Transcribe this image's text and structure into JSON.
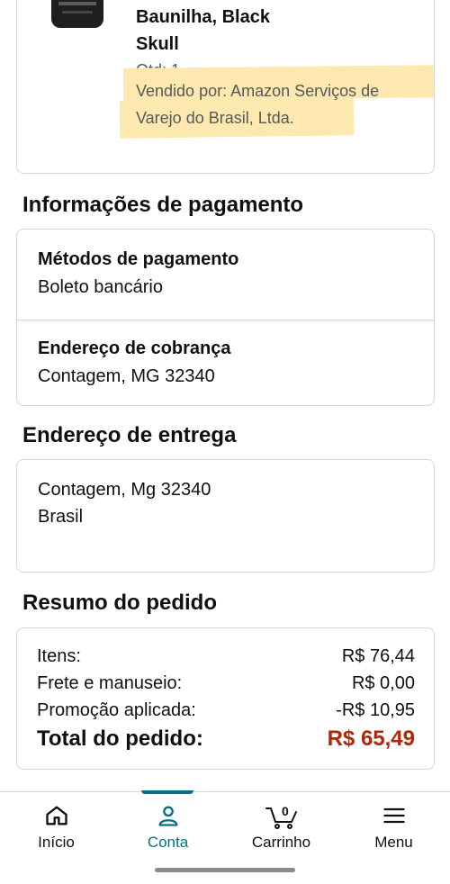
{
  "product": {
    "name_line1": "Baunilha, Black",
    "name_line2": "Skull",
    "quantity": "Qtd: 1",
    "seller_line1": "Vendido por: Amazon Serviços de",
    "seller_line2": "Varejo do Brasil, Ltda."
  },
  "payment": {
    "section_title": "Informações de pagamento",
    "methods_label": "Métodos de pagamento",
    "methods_value": "Boleto bancário",
    "billing_label": "Endereço de cobrança",
    "billing_value": "Contagem, MG 32340"
  },
  "shipping": {
    "section_title": "Endereço de entrega",
    "line1": "Contagem, Mg 32340",
    "line2": "Brasil"
  },
  "summary": {
    "section_title": "Resumo do pedido",
    "rows": [
      {
        "label": "Itens:",
        "amount": "R$ 76,44"
      },
      {
        "label": "Frete e manuseio:",
        "amount": "R$ 0,00"
      },
      {
        "label": "Promoção aplicada:",
        "amount": "-R$ 10,95"
      }
    ],
    "total_label": "Total do pedido:",
    "total_amount": "R$ 65,49"
  },
  "nav": {
    "items": [
      {
        "label": "Início",
        "icon": "home-icon"
      },
      {
        "label": "Conta",
        "icon": "user-icon",
        "active": true
      },
      {
        "label": "Carrinho",
        "icon": "cart-icon",
        "badge": "0"
      },
      {
        "label": "Menu",
        "icon": "menu-icon"
      }
    ]
  },
  "colors": {
    "accent": "#007185",
    "price_total": "#b12704",
    "highlight": "#fde9b0",
    "border": "#d5d9d9"
  }
}
